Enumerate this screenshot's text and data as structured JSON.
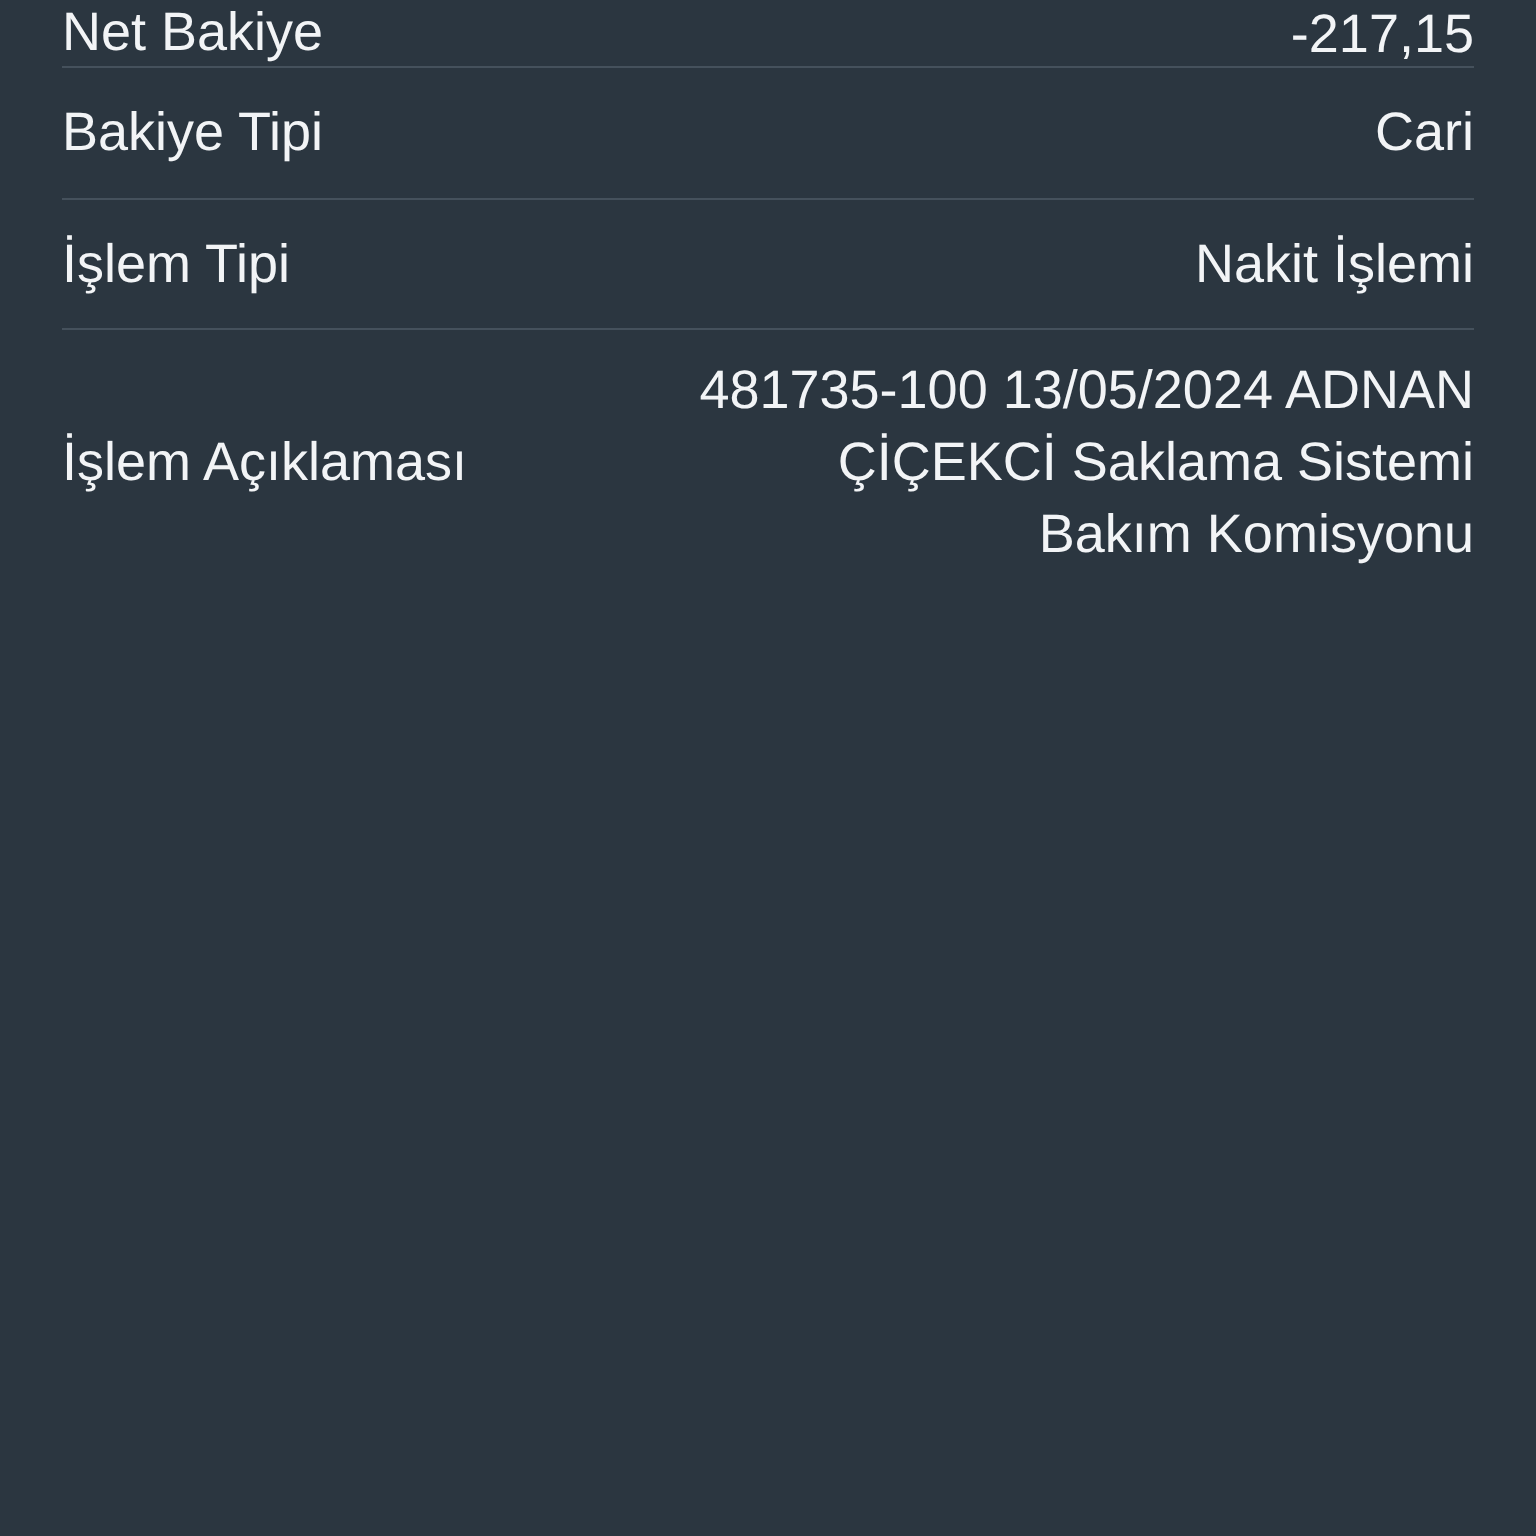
{
  "rows": [
    {
      "label": "Net Bakiye",
      "value": "-217,15"
    },
    {
      "label": "Bakiye Tipi",
      "value": "Cari"
    },
    {
      "label": "İşlem Tipi",
      "value": "Nakit İşlemi"
    },
    {
      "label": "İşlem Açıklaması",
      "value": "481735-100 13/05/2024 ADNAN ÇİÇEKCİ Saklama Sistemi Bakım Komisyonu"
    }
  ]
}
